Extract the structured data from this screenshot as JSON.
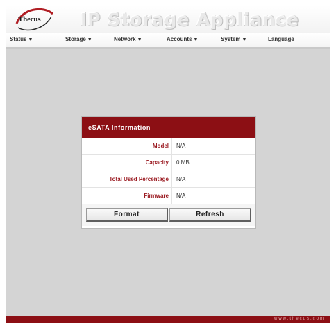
{
  "header": {
    "logo_text": "Thecus",
    "app_title": "IP Storage Appliance"
  },
  "nav": {
    "items": [
      {
        "label": "Status",
        "has_dropdown": true
      },
      {
        "label": "Storage",
        "has_dropdown": true
      },
      {
        "label": "Network",
        "has_dropdown": true
      },
      {
        "label": "Accounts",
        "has_dropdown": true
      },
      {
        "label": "System",
        "has_dropdown": true
      },
      {
        "label": "Language",
        "has_dropdown": false
      }
    ],
    "caret": "▼"
  },
  "panel": {
    "title": "eSATA Information",
    "rows": [
      {
        "label": "Model",
        "value": "N/A"
      },
      {
        "label": "Capacity",
        "value": "0 MB"
      },
      {
        "label": "Total Used Percentage",
        "value": "N/A"
      },
      {
        "label": "Firmware",
        "value": "N/A"
      }
    ],
    "buttons": {
      "format_label": "Format",
      "refresh_label": "Refresh"
    }
  },
  "footer": {
    "url": "www.thecus.com"
  },
  "colors": {
    "brand_red": "#8c0f14",
    "label_red": "#9b1b22",
    "background_gray": "#d4d4d4"
  }
}
